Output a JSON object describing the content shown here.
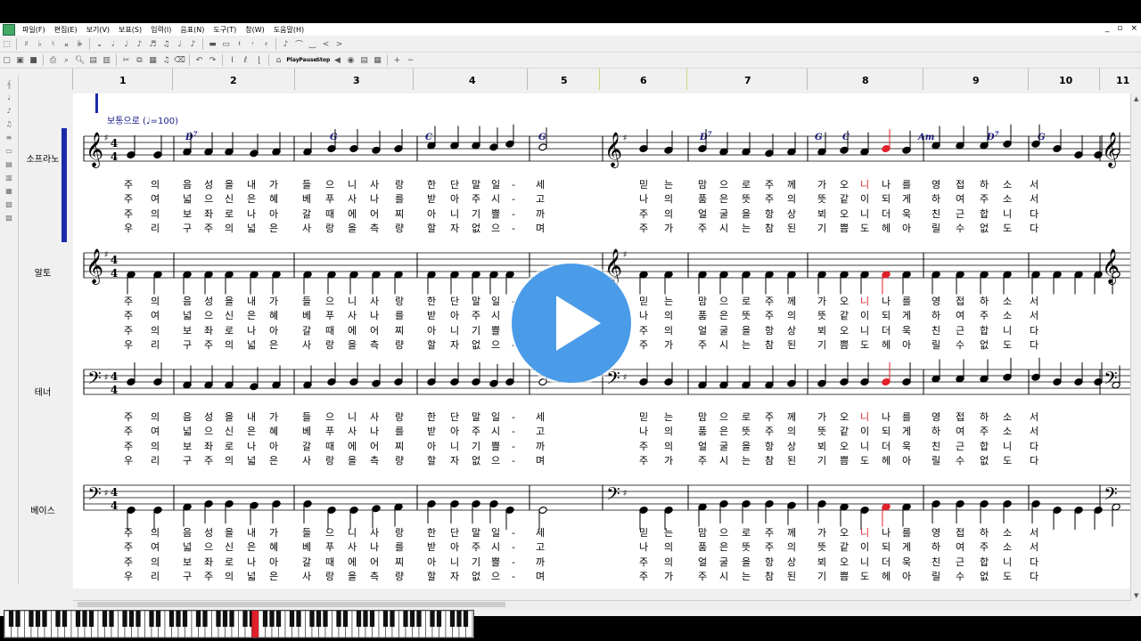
{
  "menu": {
    "items": [
      "파일(F)",
      "편집(E)",
      "보기(V)",
      "보표(S)",
      "입력(I)",
      "음표(N)",
      "도구(T)",
      "창(W)",
      "도움말(H)"
    ],
    "window_controls": [
      "_",
      "▫",
      "×"
    ]
  },
  "toolbar2": {
    "play": "Play",
    "pause": "Pause",
    "stop": "Stop"
  },
  "ruler": {
    "measures": [
      "1",
      "2",
      "3",
      "4",
      "5",
      "6",
      "7",
      "8",
      "9",
      "10",
      "11"
    ]
  },
  "tempo": {
    "text": "보통으로",
    "bpm": "=100"
  },
  "parts": [
    {
      "name": "소프라노",
      "clef": "treble"
    },
    {
      "name": "알토",
      "clef": "treble"
    },
    {
      "name": "테너",
      "clef": "bass"
    },
    {
      "name": "베이스",
      "clef": "bass"
    }
  ],
  "chords": [
    {
      "label": "D7",
      "sup": "7",
      "base": "D"
    },
    {
      "label": "G",
      "sup": "",
      "base": "G"
    },
    {
      "label": "C",
      "sup": "",
      "base": "C"
    },
    {
      "label": "G",
      "sup": "",
      "base": "G"
    },
    {
      "label": "D7",
      "sup": "7",
      "base": "D"
    },
    {
      "label": "G",
      "sup": "",
      "base": "G"
    },
    {
      "label": "C",
      "sup": "",
      "base": "C"
    },
    {
      "label": "Am",
      "sup": "",
      "base": "Am"
    },
    {
      "label": "D7",
      "sup": "7",
      "base": "D"
    },
    {
      "label": "G",
      "sup": "",
      "base": "G"
    }
  ],
  "lyrics": {
    "left": [
      [
        "주",
        "의",
        "음",
        "성",
        "을",
        "내",
        "가",
        "들",
        "으",
        "니",
        "사",
        "랑",
        "한",
        "단",
        "말",
        "일",
        "-",
        "세"
      ],
      [
        "주",
        "여",
        "넓",
        "으",
        "신",
        "은",
        "혜",
        "베",
        "푸",
        "사",
        "나",
        "를",
        "받",
        "아",
        "주",
        "시",
        "-",
        "고"
      ],
      [
        "주",
        "의",
        "보",
        "좌",
        "로",
        "나",
        "아",
        "갈",
        "때",
        "에",
        "어",
        "찌",
        "아",
        "니",
        "기",
        "쁠",
        "-",
        "까"
      ],
      [
        "우",
        "리",
        "구",
        "주",
        "의",
        "넓",
        "은",
        "사",
        "랑",
        "을",
        "측",
        "량",
        "할",
        "자",
        "없",
        "으",
        "-",
        "며"
      ]
    ],
    "right": [
      [
        "믿",
        "는",
        "맘",
        "으",
        "로",
        "주",
        "께",
        "가",
        "오",
        "니",
        "나",
        "를",
        "영",
        "접",
        "하",
        "소",
        "서"
      ],
      [
        "나",
        "의",
        "품",
        "은",
        "뜻",
        "주",
        "의",
        "뜻",
        "같",
        "이",
        "되",
        "게",
        "하",
        "여",
        "주",
        "소",
        "서"
      ],
      [
        "주",
        "의",
        "얼",
        "굴",
        "을",
        "항",
        "상",
        "뵈",
        "오",
        "니",
        "더",
        "욱",
        "친",
        "근",
        "합",
        "니",
        "다"
      ],
      [
        "주",
        "가",
        "주",
        "시",
        "는",
        "참",
        "된",
        "기",
        "쁨",
        "도",
        "헤",
        "아",
        "릴",
        "수",
        "없",
        "도",
        "다"
      ]
    ]
  },
  "colors": {
    "lyric": "#000000",
    "highlight": "#e0202a",
    "chord": "#1a1a8c",
    "accent": "#1a2aa8",
    "play_button": "#4a9be8"
  }
}
